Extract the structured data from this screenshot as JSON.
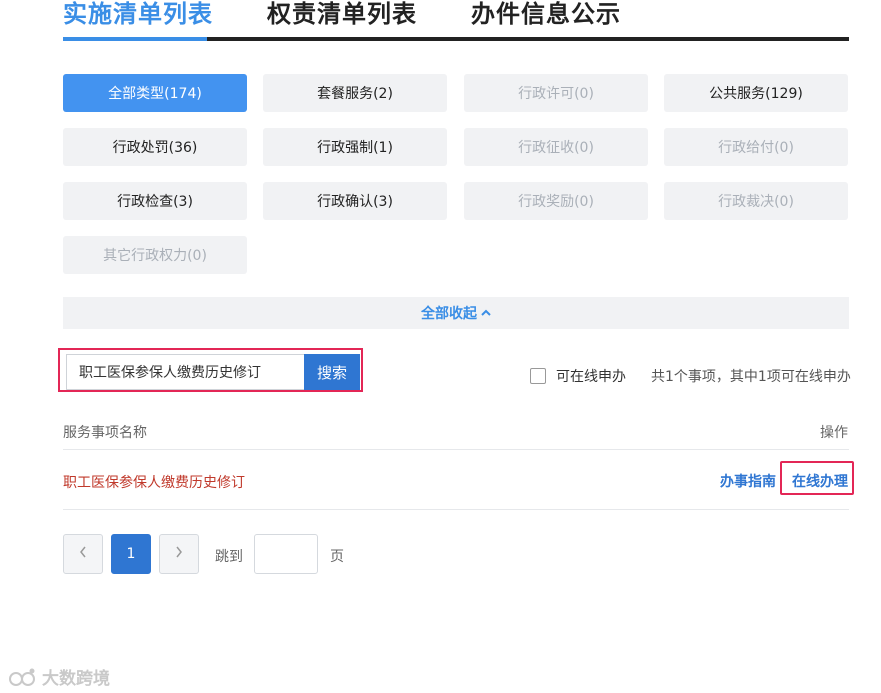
{
  "tabs": [
    {
      "label": "实施清单列表",
      "active": true
    },
    {
      "label": "权责清单列表",
      "active": false
    },
    {
      "label": "办件信息公示",
      "active": false
    }
  ],
  "categories": [
    {
      "label": "全部类型(174)",
      "state": "active"
    },
    {
      "label": "套餐服务(2)",
      "state": "normal"
    },
    {
      "label": "行政许可(0)",
      "state": "disabled"
    },
    {
      "label": "公共服务(129)",
      "state": "normal"
    },
    {
      "label": "行政处罚(36)",
      "state": "normal"
    },
    {
      "label": "行政强制(1)",
      "state": "normal"
    },
    {
      "label": "行政征收(0)",
      "state": "disabled"
    },
    {
      "label": "行政给付(0)",
      "state": "disabled"
    },
    {
      "label": "行政检查(3)",
      "state": "normal"
    },
    {
      "label": "行政确认(3)",
      "state": "normal"
    },
    {
      "label": "行政奖励(0)",
      "state": "disabled"
    },
    {
      "label": "行政裁决(0)",
      "state": "disabled"
    },
    {
      "label": "其它行政权力(0)",
      "state": "disabled"
    }
  ],
  "collapse": {
    "label": "全部收起",
    "icon": "chevron-up-icon"
  },
  "search": {
    "value": "职工医保参保人缴费历史修订",
    "button_label": "搜索"
  },
  "filter": {
    "online_label": "可在线申办",
    "checked": false
  },
  "summary": "共1个事项，其中1项可在线申办",
  "table": {
    "headers": {
      "name": "服务事项名称",
      "action": "操作"
    },
    "rows": [
      {
        "name": "职工医保参保人缴费历史修订",
        "guide": "办事指南",
        "online": "在线办理"
      }
    ]
  },
  "pagination": {
    "prev_icon": "chevron-left-icon",
    "current": "1",
    "next_icon": "chevron-right-icon",
    "jump_label": "跳到",
    "page_suffix": "页"
  },
  "watermark": {
    "text": "大数跨境"
  },
  "colors": {
    "accent": "#3a8ee6",
    "primary": "#2f76d2",
    "highlight_border": "#e32656",
    "row_name": "#c0392b"
  }
}
